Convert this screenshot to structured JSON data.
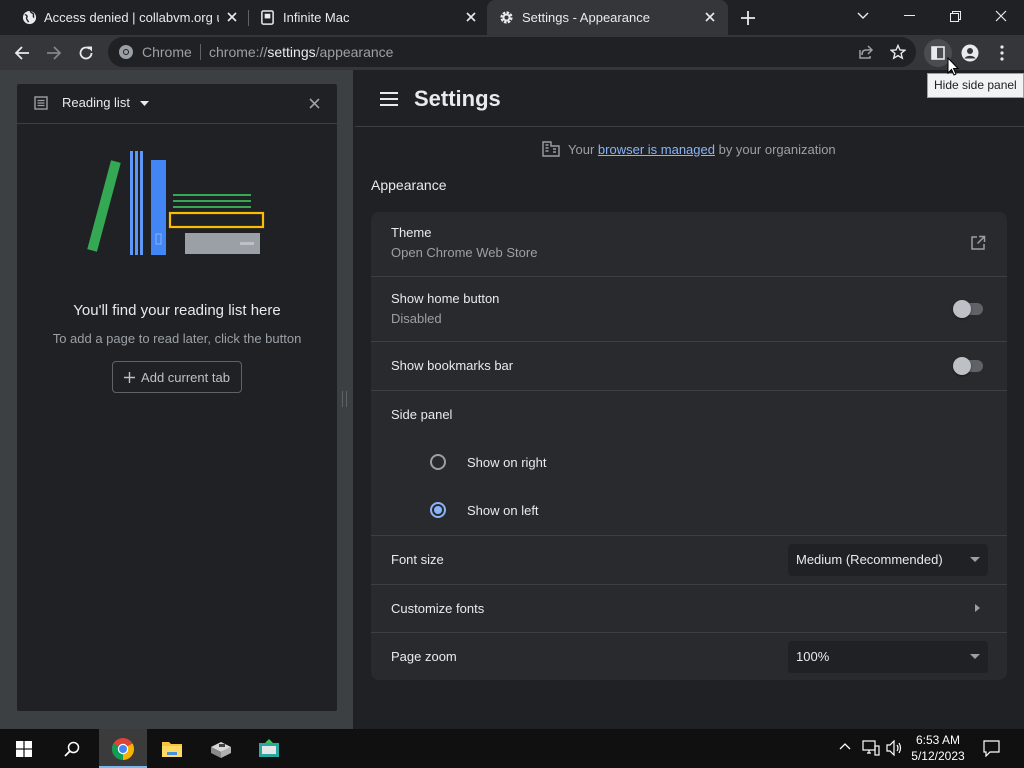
{
  "tabs": [
    {
      "title": "Access denied | collabvm.org use",
      "icon": "globe-icon",
      "active": false
    },
    {
      "title": "Infinite Mac",
      "icon": "document-icon",
      "active": false
    },
    {
      "title": "Settings - Appearance",
      "icon": "gear-icon",
      "active": true
    }
  ],
  "toolbar": {
    "chrome_label": "Chrome",
    "url_scheme": "chrome://",
    "url_host": "settings",
    "url_path": "/appearance"
  },
  "tooltip": "Hide side panel",
  "side_panel": {
    "title": "Reading list",
    "empty_title": "You'll find your reading list here",
    "empty_desc": "To add a page to read later, click the button",
    "add_button": "Add current tab"
  },
  "settings": {
    "title": "Settings",
    "managed": {
      "prefix": "Your",
      "link": "browser is managed",
      "suffix": "by your organization"
    },
    "section": "Appearance",
    "theme": {
      "label": "Theme",
      "sub": "Open Chrome Web Store"
    },
    "home_button": {
      "label": "Show home button",
      "sub": "Disabled",
      "enabled": false
    },
    "bookmarks_bar": {
      "label": "Show bookmarks bar",
      "enabled": false
    },
    "side_panel": {
      "label": "Side panel",
      "options": [
        {
          "label": "Show on right",
          "checked": false
        },
        {
          "label": "Show on left",
          "checked": true
        }
      ]
    },
    "font_size": {
      "label": "Font size",
      "value": "Medium (Recommended)"
    },
    "customize_fonts": {
      "label": "Customize fonts"
    },
    "page_zoom": {
      "label": "Page zoom",
      "value": "100%"
    }
  },
  "taskbar": {
    "time": "6:53 AM",
    "date": "5/12/2023"
  },
  "colors": {
    "accent": "#8ab4f8",
    "background": "#202124",
    "toolbar": "#35363a",
    "card": "#292a2d"
  }
}
